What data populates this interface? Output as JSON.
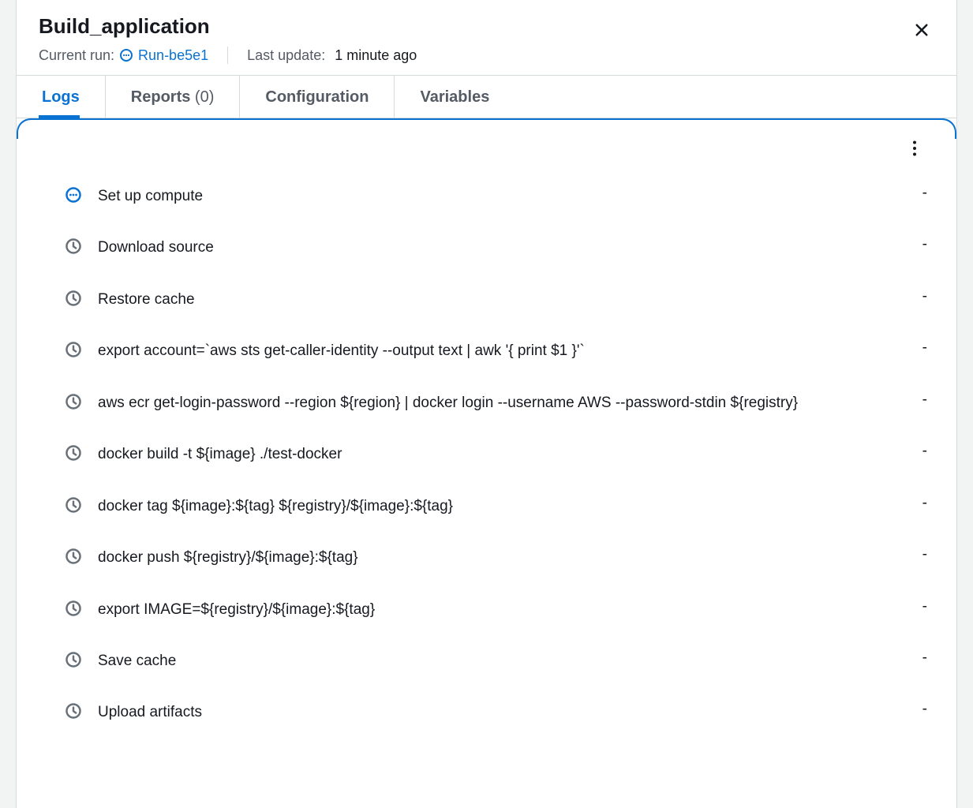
{
  "header": {
    "title": "Build_application",
    "current_run_label": "Current run:",
    "run_link": "Run-be5e1",
    "last_update_label": "Last update:",
    "last_update_value": "1 minute ago"
  },
  "tabs": [
    {
      "id": "logs",
      "label": "Logs",
      "count": null,
      "active": true
    },
    {
      "id": "reports",
      "label": "Reports",
      "count": "(0)",
      "active": false
    },
    {
      "id": "configuration",
      "label": "Configuration",
      "count": null,
      "active": false
    },
    {
      "id": "variables",
      "label": "Variables",
      "count": null,
      "active": false
    }
  ],
  "steps": [
    {
      "status": "in-progress",
      "text": "Set up compute",
      "duration": "-"
    },
    {
      "status": "pending",
      "text": "Download source",
      "duration": "-"
    },
    {
      "status": "pending",
      "text": "Restore cache",
      "duration": "-"
    },
    {
      "status": "pending",
      "text": "export account=`aws sts get-caller-identity --output text | awk '{ print $1 }'`",
      "duration": "-"
    },
    {
      "status": "pending",
      "text": "aws ecr get-login-password --region ${region} | docker login --username AWS --password-stdin ${registry}",
      "duration": "-"
    },
    {
      "status": "pending",
      "text": "docker build -t ${image} ./test-docker",
      "duration": "-"
    },
    {
      "status": "pending",
      "text": "docker tag ${image}:${tag} ${registry}/${image}:${tag}",
      "duration": "-"
    },
    {
      "status": "pending",
      "text": "docker push ${registry}/${image}:${tag}",
      "duration": "-"
    },
    {
      "status": "pending",
      "text": "export IMAGE=${registry}/${image}:${tag}",
      "duration": "-"
    },
    {
      "status": "pending",
      "text": "Save cache",
      "duration": "-"
    },
    {
      "status": "pending",
      "text": "Upload artifacts",
      "duration": "-"
    }
  ],
  "icons": {
    "in_progress_color": "#0972d3",
    "pending_color": "#687078"
  }
}
